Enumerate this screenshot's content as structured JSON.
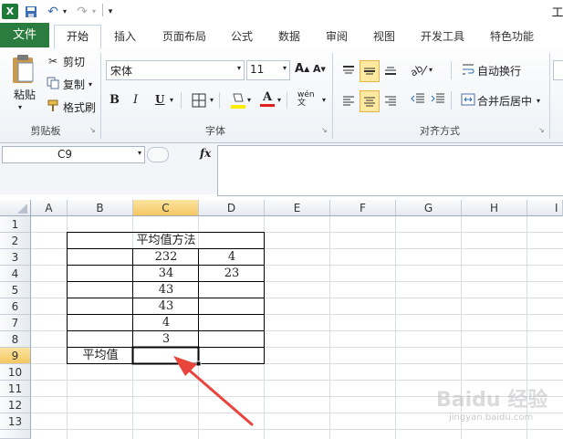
{
  "titlebar": {
    "right_glyph": "工"
  },
  "tabs": {
    "file": "文件",
    "home": "开始",
    "insert": "插入",
    "page_layout": "页面布局",
    "formulas": "公式",
    "data": "数据",
    "review": "审阅",
    "view": "视图",
    "developer": "开发工具",
    "features": "特色功能"
  },
  "clipboard": {
    "paste": "粘贴",
    "cut": "剪切",
    "copy": "复制",
    "format_painter": "格式刷",
    "label": "剪贴板"
  },
  "font": {
    "name": "宋体",
    "size": "11",
    "bold": "B",
    "italic": "I",
    "underline": "U",
    "label": "字体",
    "grow": "A",
    "shrink": "A",
    "font_color_glyph": "A",
    "phonetic_glyph": "wén 文"
  },
  "alignment": {
    "wrap": "自动换行",
    "merge": "合并后居中",
    "label": "对齐方式"
  },
  "formula_bar": {
    "name_box": "C9",
    "fx": "fx"
  },
  "columns": [
    "A",
    "B",
    "C",
    "D",
    "E",
    "F",
    "G",
    "H",
    "I"
  ],
  "rows": [
    "1",
    "2",
    "3",
    "4",
    "5",
    "6",
    "7",
    "8",
    "9",
    "10",
    "11",
    "12",
    "13"
  ],
  "sheet": {
    "title": "平均值方法",
    "c_values": [
      "232",
      "34",
      "43",
      "43",
      "4",
      "3"
    ],
    "d_values": [
      "4",
      "23"
    ],
    "b9": "平均值"
  },
  "watermark": {
    "brand": "Baidu 经验",
    "url": "jingyan.baidu.com"
  },
  "colors": {
    "file_tab": "#2a7d3e",
    "selected_header": "#f4c761",
    "arrow": "#e8453c"
  }
}
